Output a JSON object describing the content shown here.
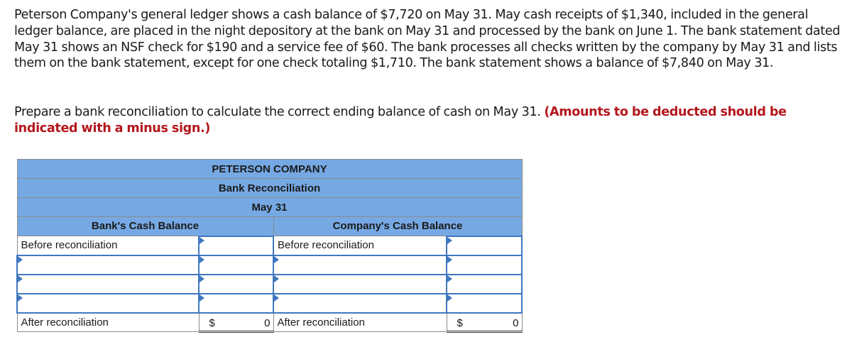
{
  "problem_text": "Peterson Company's general ledger shows a cash balance of $7,720 on May 31. May cash receipts of $1,340, included in the general ledger balance, are placed in the night depository at the bank on May 31 and processed by the bank on June 1. The bank statement dated May 31 shows an NSF check for $190 and a service fee of $60. The bank processes all checks written by the company by May 31 and lists them on the bank statement, except for one check totaling $1,710. The bank statement shows a balance of $7,840 on May 31.",
  "instruction": {
    "text": "Prepare a bank reconciliation to calculate the correct ending balance of cash on May 31.",
    "note": "(Amounts to be deducted should be indicated with a minus sign.)"
  },
  "table": {
    "company": "PETERSON COMPANY",
    "title": "Bank Reconciliation",
    "date": "May 31",
    "bank_side": {
      "header": "Bank's Cash Balance",
      "before_label": "Before reconciliation",
      "before_value": "",
      "adjustments": [
        {
          "label": "",
          "amount": ""
        },
        {
          "label": "",
          "amount": ""
        },
        {
          "label": "",
          "amount": ""
        }
      ],
      "after_label": "After reconciliation",
      "after_currency": "$",
      "after_value": "0"
    },
    "company_side": {
      "header": "Company's Cash Balance",
      "before_label": "Before reconciliation",
      "before_value": "",
      "adjustments": [
        {
          "label": "",
          "amount": ""
        },
        {
          "label": "",
          "amount": ""
        },
        {
          "label": "",
          "amount": ""
        }
      ],
      "after_label": "After reconciliation",
      "after_currency": "$",
      "after_value": "0"
    }
  },
  "colors": {
    "header_bg": "#76a9e4",
    "input_border": "#3f78c0",
    "note_red": "#b3171d"
  }
}
